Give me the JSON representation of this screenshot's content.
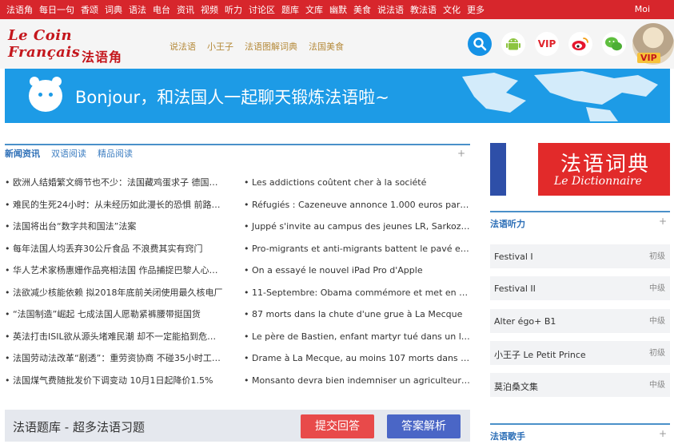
{
  "topnav": {
    "items": [
      "法语角",
      "每日一句",
      "香颂",
      "词典",
      "语法",
      "电台",
      "资讯",
      "视频",
      "听力",
      "讨论区",
      "题库",
      "文库",
      "幽默",
      "美食",
      "说法语",
      "教法语",
      "文化",
      "更多"
    ],
    "login": "Moi"
  },
  "header": {
    "logo_fr": "Le Coin Français",
    "logo_cn": "法语角",
    "links": [
      "说法语",
      "小王子",
      "法语图解词典",
      "法国美食"
    ],
    "vip_label": "VIP",
    "avatar_tag": "VIP"
  },
  "banner": {
    "text": "Bonjour，和法国人一起聊天锻炼法语啦~"
  },
  "news": {
    "tabs": [
      "新闻资讯",
      "双语阅读",
      "精品阅读"
    ],
    "plus": "+",
    "left": [
      "• 欧洲人结婚繁文缛节也不少：法国藏鸡蛋求子 德国…",
      "• 难民的生死24小时：从未经历如此漫长的恐惧 前路…",
      "• 法国将出台“数字共和国法”法案",
      "• 每年法国人均丢弃30公斤食品 不浪费其实有窍门",
      "• 华人艺术家杨惠姗作品亮相法国 作品捕捉巴黎人心…",
      "• 法欲减少核能依赖 拟2018年底前关闭使用最久核电厂",
      "• “法国制造”崛起 七成法国人愿勒紧裤腰带挺国货",
      "• 英法打击ISIL欲从源头堵难民潮 却不一定能掐到危…",
      "• 法国劳动法改革“剧透”：重劳资协商 不碰35小时工…",
      "• 法国煤气费随批发价下调变动 10月1日起降价1.5%"
    ],
    "right": [
      "• Les addictions coûtent cher à la société",
      "• Réfugiés : Cazeneuve annonce 1.000 euros par p…",
      "• Juppé s'invite au campus des jeunes LR, Sarkozy…",
      "• Pro-migrants et anti-migrants battent le pavé en E…",
      "• On a essayé le nouvel iPad Pro d'Apple",
      "• 11-Septembre: Obama commémore et met en ga…",
      "• 87 morts dans la chute d'une grue à La Mecque",
      "• Le père de Bastien, enfant martyr tué dans un lav…",
      "• Drame à La Mecque, au moins 107 morts dans la…",
      "• Monsanto devra bien indemniser un agriculteur in…"
    ]
  },
  "quiz": {
    "title": "法语题库 - 超多法语习题",
    "submit": "提交回答",
    "answer": "答案解析"
  },
  "dict": {
    "title": "法语词典",
    "subtitle": "Le Dictionnaire"
  },
  "listening": {
    "title": "法语听力",
    "plus": "+",
    "items": [
      {
        "name": "Festival I",
        "level": "初级"
      },
      {
        "name": "Festival II",
        "level": "中级"
      },
      {
        "name": "Alter égo+ B1",
        "level": "中级"
      },
      {
        "name": "小王子 Le Petit Prince",
        "level": "初级"
      },
      {
        "name": "莫泊桑文集",
        "level": "中级"
      }
    ]
  },
  "singers": {
    "title": "法语歌手",
    "plus": "+"
  },
  "colors": {
    "topnav": "#d7262c",
    "accent_blue": "#1d9be6",
    "submit_btn": "#e84a4a",
    "answer_btn": "#4a66c6"
  }
}
